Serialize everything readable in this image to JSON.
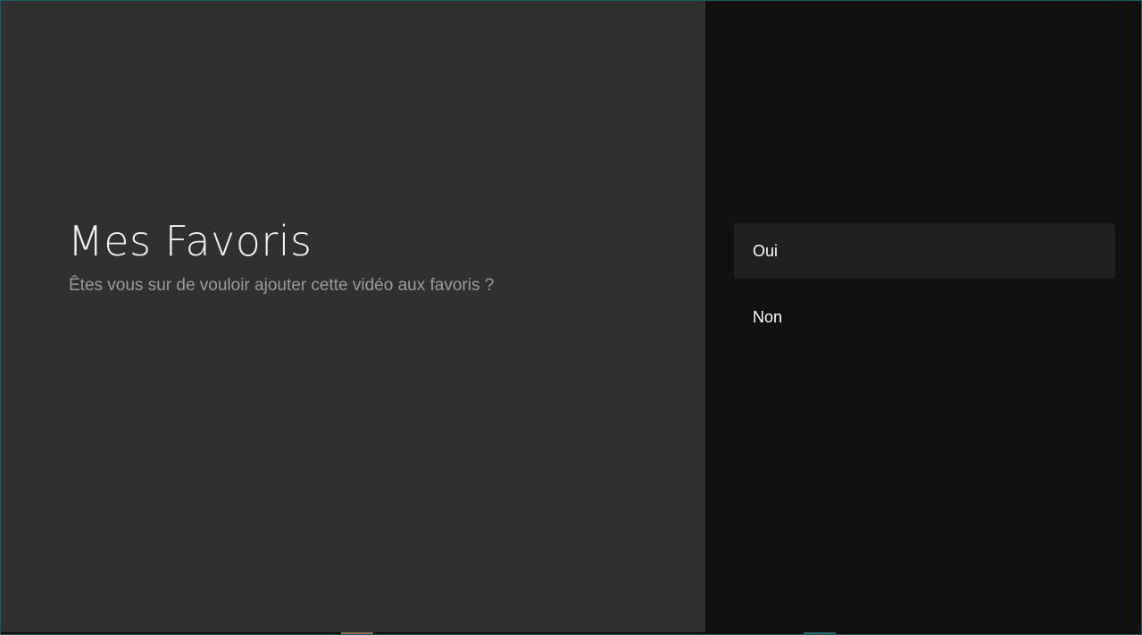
{
  "dialog": {
    "title": "Mes Favoris",
    "description": "Êtes vous sur de vouloir ajouter cette vidéo aux favoris ?"
  },
  "actions": [
    {
      "label": "Oui",
      "focused": true
    },
    {
      "label": "Non",
      "focused": false
    }
  ],
  "colors": {
    "left_panel": "#303030",
    "right_panel": "#111111",
    "focused_action": "#202020",
    "accent_teal": "#2e6a6a",
    "accent_gold": "#8a7350"
  }
}
